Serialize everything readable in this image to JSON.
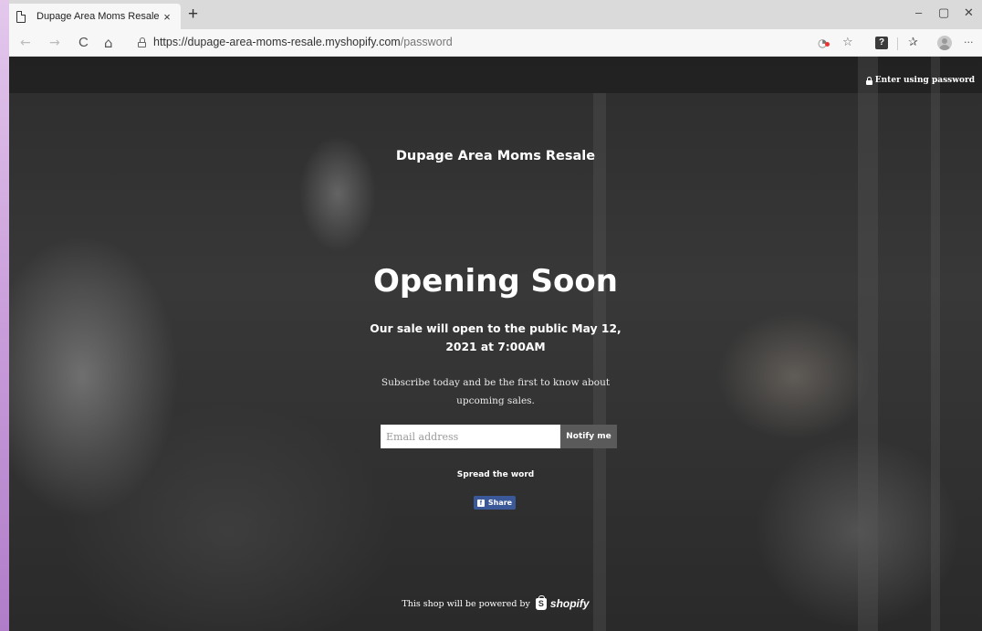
{
  "browser": {
    "tab_title": "Dupage Area Moms Resale",
    "tab_close": "×",
    "new_tab": "+",
    "window_controls": {
      "minimize": "–",
      "maximize": "▢",
      "close": "✕"
    },
    "nav": {
      "back": "←",
      "forward": "→",
      "refresh": "C",
      "home": "⌂"
    },
    "url_host": "https://dupage-area-moms-resale.myshopify.com",
    "url_path": "/password",
    "toolbar_icons": [
      "tracking-prevention-icon",
      "add-favorite-icon",
      "extension-icon",
      "favorites-icon",
      "profile-icon",
      "more-icon"
    ],
    "extension_label": "?",
    "favorites_glyph": "✰",
    "more_glyph": "···"
  },
  "page": {
    "enter_password": "Enter using password",
    "shop_name": "Dupage Area Moms Resale",
    "heading": "Opening Soon",
    "sale_message": "Our sale will open to the public May 12, 2021 at 7:00AM",
    "subscribe_text": "Subscribe today and be the first to know about upcoming sales.",
    "email_placeholder": "Email address",
    "notify_label": "Notify me",
    "spread_label": "Spread the word",
    "share_label": "Share",
    "share_icon": "f",
    "powered_text": "This shop will be powered by",
    "powered_brand": "shopify"
  },
  "colors": {
    "facebook": "#3b5998",
    "notify_button": "#5a5a5a",
    "page_bg": "#2d2d2d"
  }
}
